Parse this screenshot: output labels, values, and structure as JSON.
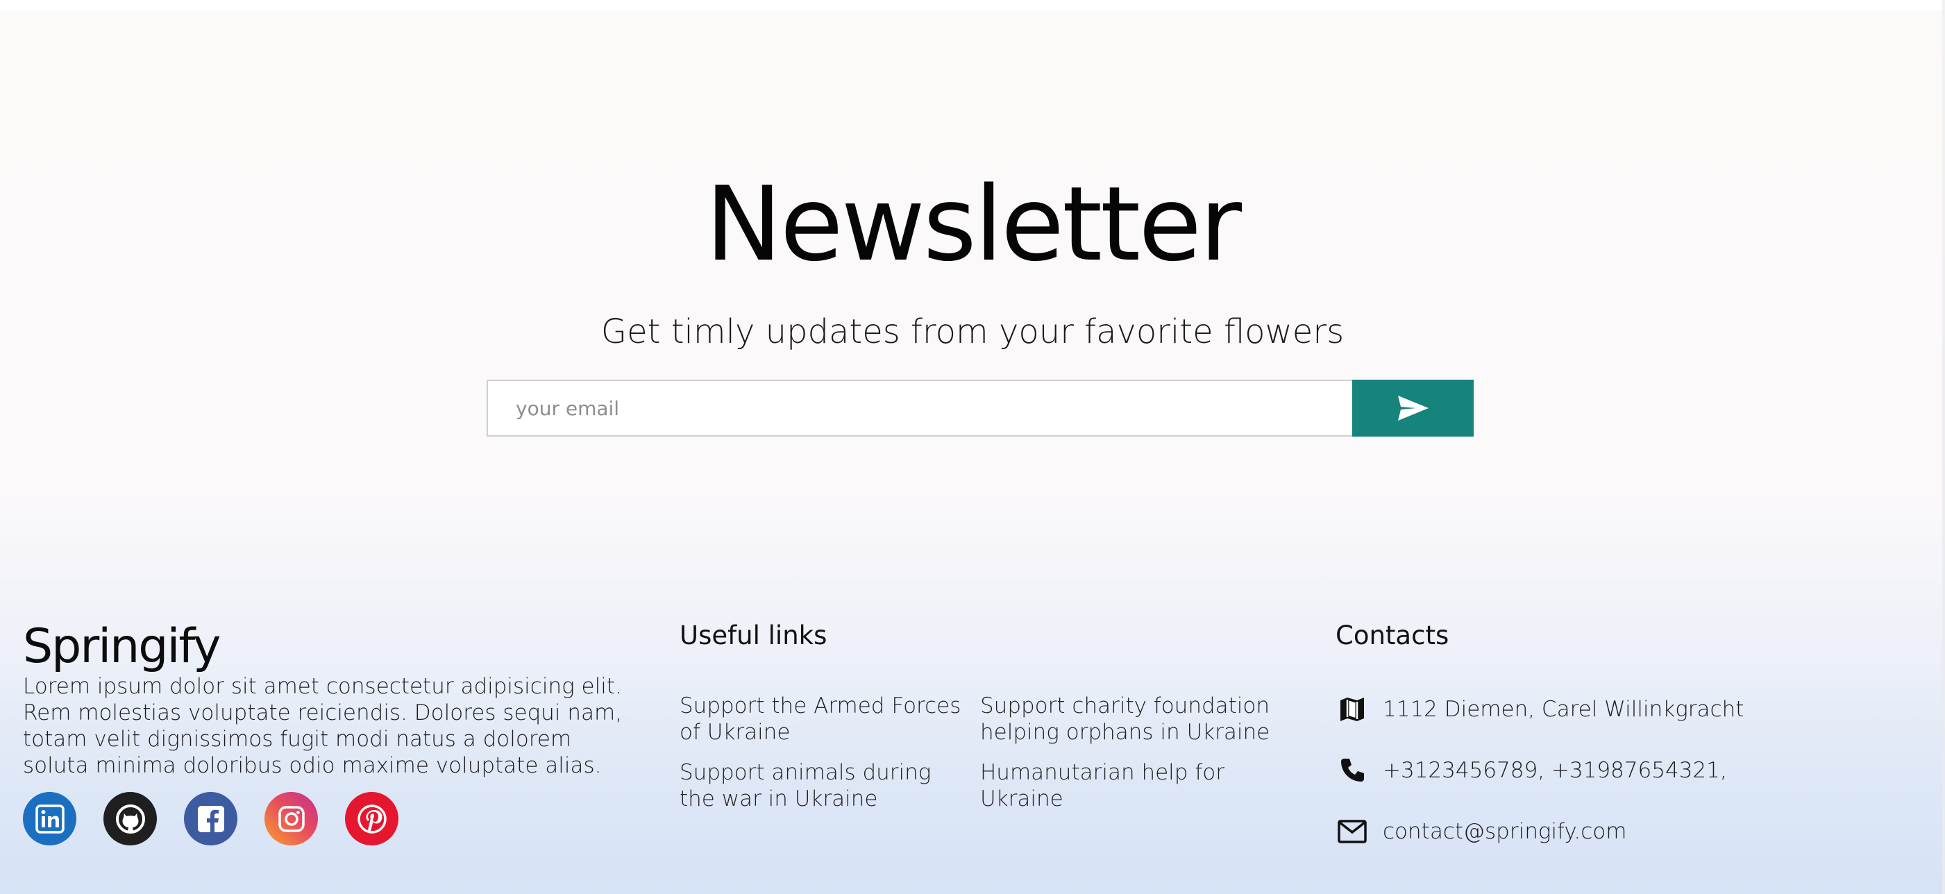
{
  "newsletter": {
    "title": "Newsletter",
    "subtitle": "Get timly updates from your favorite flowers",
    "email_placeholder": "your email",
    "send_icon": "paper-plane-icon"
  },
  "footer": {
    "brand": "Springify",
    "about": "Lorem ipsum dolor sit amet consectetur adipisicing elit. Rem molestias voluptate reiciendis. Dolores sequi nam, totam velit dignissimos fugit modi natus a dolorem soluta minima doloribus odio maxime voluptate alias.",
    "social": [
      {
        "icon": "linkedin-icon",
        "color": "#1b6fc0"
      },
      {
        "icon": "github-icon",
        "color": "#1f1f1f"
      },
      {
        "icon": "facebook-icon",
        "color": "#3c5ba0"
      },
      {
        "icon": "instagram-icon",
        "color": "#e84a5f"
      },
      {
        "icon": "pinterest-icon",
        "color": "#e4172f"
      }
    ],
    "useful_links": {
      "heading": "Useful links",
      "items": [
        "Support the Armed Forces of Ukraine",
        "Support charity foundation helping orphans in Ukraine",
        "Support animals during the war in Ukraine",
        "Humanutarian help for Ukraine"
      ]
    },
    "contacts": {
      "heading": "Contacts",
      "address": "1112 Diemen, Carel Willinkgracht",
      "phone": "+3123456789, +31987654321,",
      "email": "contact@springify.com",
      "address_icon": "map-icon",
      "phone_icon": "phone-icon",
      "email_icon": "mail-icon"
    }
  },
  "colors": {
    "accent": "#16837c"
  }
}
